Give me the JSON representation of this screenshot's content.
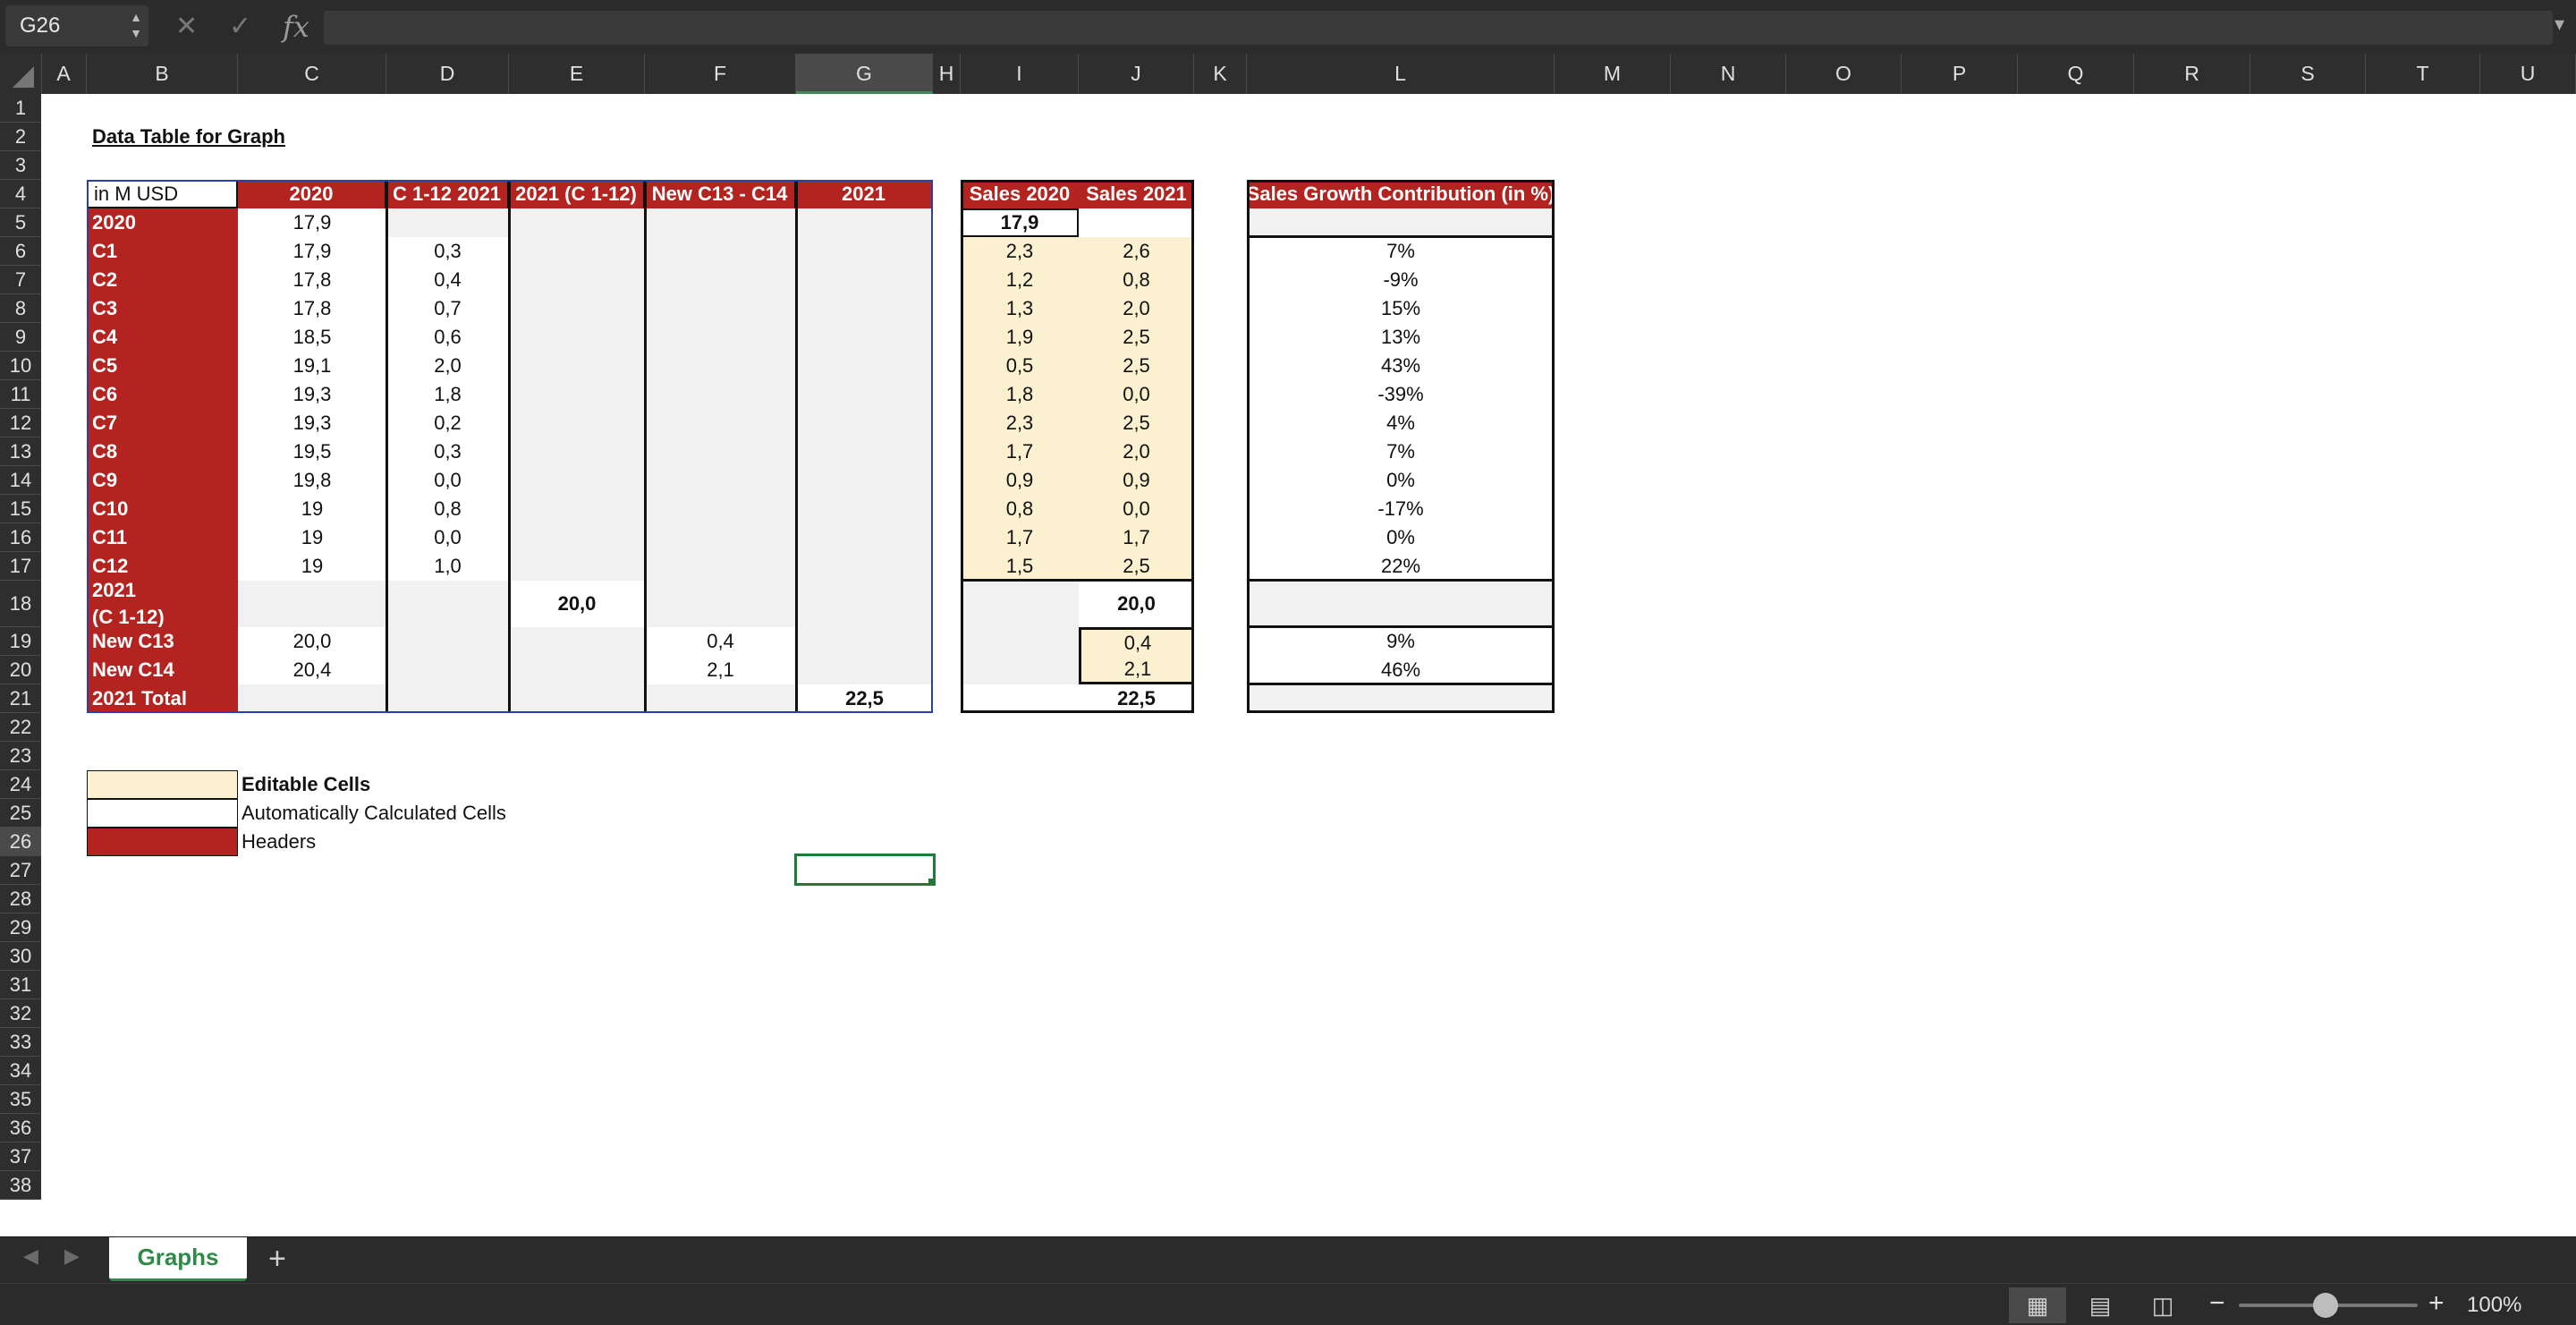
{
  "formula_bar": {
    "name_box": "G26",
    "fx_label": "fx",
    "formula": ""
  },
  "columns": [
    "A",
    "B",
    "C",
    "D",
    "E",
    "F",
    "G",
    "H",
    "I",
    "J",
    "K",
    "L",
    "M",
    "N",
    "O",
    "P",
    "Q",
    "R",
    "S",
    "T",
    "U"
  ],
  "selected_column": "G",
  "rows": [
    "1",
    "2",
    "3",
    "4",
    "5",
    "6",
    "7",
    "8",
    "9",
    "10",
    "11",
    "12",
    "13",
    "14",
    "15",
    "16",
    "17",
    "18",
    "19",
    "20",
    "21",
    "22",
    "23",
    "24",
    "25",
    "26",
    "27",
    "28",
    "29",
    "30",
    "31",
    "32",
    "33",
    "34",
    "35",
    "36",
    "37",
    "38"
  ],
  "selected_row": "26",
  "sheet": {
    "title": "Data Table for Graph",
    "table1": {
      "corner": "in M USD",
      "headers": [
        "2020",
        "C 1-12 2021",
        "2021 (C 1-12)",
        "New C13 - C14",
        "2021"
      ],
      "row_labels": [
        "2020",
        "C1",
        "C2",
        "C3",
        "C4",
        "C5",
        "C6",
        "C7",
        "C8",
        "C9",
        "C10",
        "C11",
        "C12",
        "2021",
        "(C 1-12)",
        "New C13",
        "New C14",
        "2021 Total"
      ],
      "col_2020": [
        "17,9",
        "17,9",
        "17,8",
        "17,8",
        "18,5",
        "19,1",
        "19,3",
        "19,3",
        "19,5",
        "19,8",
        "19",
        "19",
        "19",
        "",
        "",
        "20,0",
        "20,4",
        ""
      ],
      "col_c112": [
        "",
        "0,3",
        "0,4",
        "0,7",
        "0,6",
        "2,0",
        "1,8",
        "0,2",
        "0,3",
        "0,0",
        "0,8",
        "0,0",
        "1,0"
      ],
      "col_2021_c112": "20,0",
      "col_new": [
        "0,4",
        "2,1"
      ],
      "total_2021": "22,5"
    },
    "table2": {
      "headers": [
        "Sales 2020",
        "Sales 2021"
      ],
      "first_row": "17,9",
      "sales_2020": [
        "2,3",
        "1,2",
        "1,3",
        "1,9",
        "0,5",
        "1,8",
        "2,3",
        "1,7",
        "0,9",
        "0,8",
        "1,7",
        "1,5"
      ],
      "sales_2021": [
        "2,6",
        "0,8",
        "2,0",
        "2,5",
        "2,5",
        "0,0",
        "2,5",
        "2,0",
        "0,9",
        "0,0",
        "1,7",
        "2,5"
      ],
      "total_2021_c112": "20,0",
      "new_sales": [
        "0,4",
        "2,1"
      ],
      "total": "22,5"
    },
    "table3": {
      "header": "Sales Growth Contribution (in %)",
      "values": [
        "7%",
        "-9%",
        "15%",
        "13%",
        "43%",
        "-39%",
        "4%",
        "7%",
        "0%",
        "-17%",
        "0%",
        "22%"
      ],
      "new_values": [
        "9%",
        "46%"
      ]
    },
    "legend": {
      "editable": "Editable Cells",
      "auto": "Automatically Calculated Cells",
      "headers": "Headers"
    }
  },
  "tabs": {
    "active": "Graphs",
    "add": "+"
  },
  "status": {
    "zoom": "100%"
  },
  "colors": {
    "header_red": "#b32320",
    "editable_cream": "#fbf0cf",
    "selection_green": "#2e8a47"
  }
}
